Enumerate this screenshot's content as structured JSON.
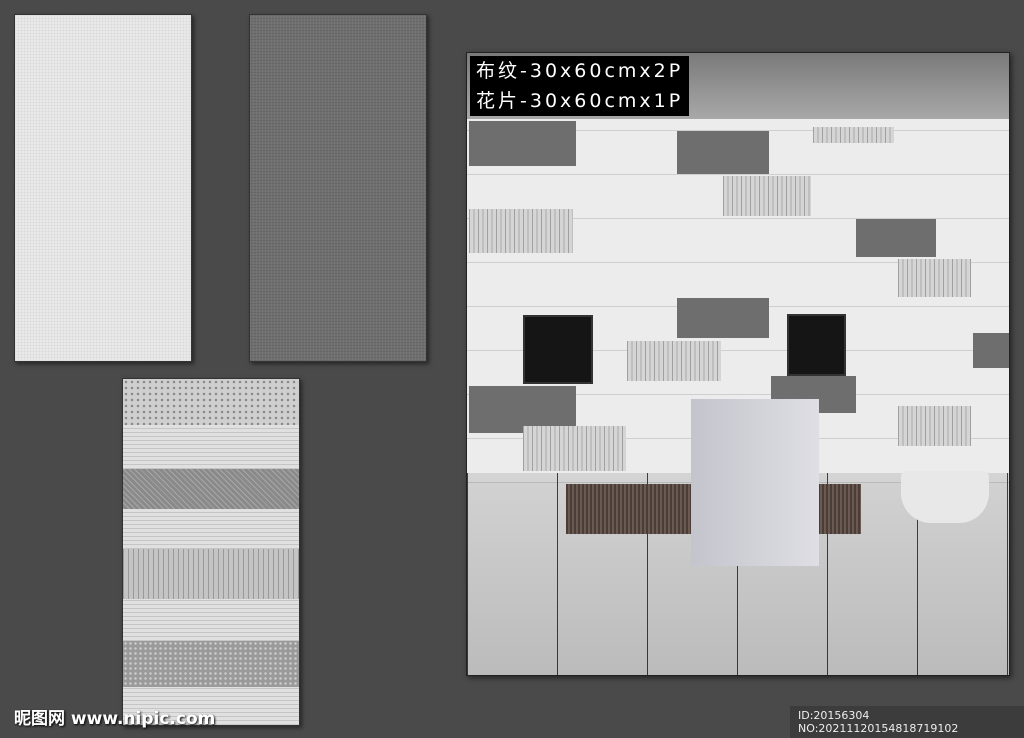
{
  "caption": {
    "line1": "布纹-30x60cmx2P",
    "line2": "花片-30x60cmx1P"
  },
  "watermark": {
    "text": "昵图网 www.nipic.com"
  },
  "image_id": {
    "text": "ID:20156304 NO:20211120154818719102"
  },
  "colors": {
    "background": "#4a4a4a",
    "light_tile": "#e9e9e9",
    "dark_tile": "#6f6f6f"
  }
}
